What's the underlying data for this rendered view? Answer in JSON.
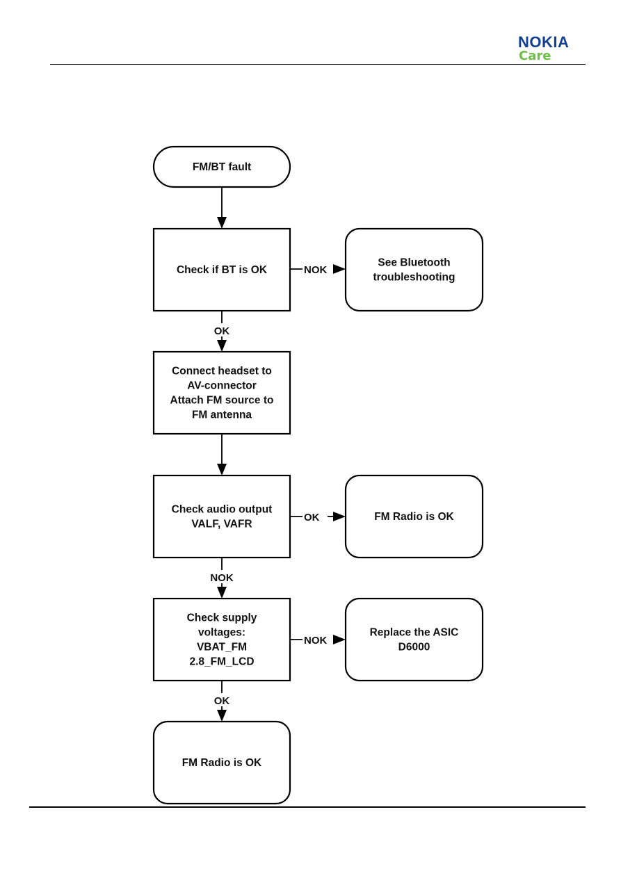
{
  "header": {
    "brand": "NOKIA",
    "subbrand": "Care",
    "brand_color": "#124191",
    "subbrand_color": "#6cbe45"
  },
  "flowchart": {
    "nodes": [
      {
        "id": "start",
        "shape": "terminator",
        "lines": [
          "FM/BT fault"
        ]
      },
      {
        "id": "check_bt",
        "shape": "process",
        "lines": [
          "Check if BT is OK"
        ]
      },
      {
        "id": "bt_trouble",
        "shape": "rounded",
        "lines": [
          "See Bluetooth",
          "troubleshooting"
        ]
      },
      {
        "id": "connect",
        "shape": "process",
        "lines": [
          "Connect headset to",
          "AV-connector",
          "Attach FM source to",
          "FM antenna"
        ]
      },
      {
        "id": "check_audio",
        "shape": "process",
        "lines": [
          "Check audio output",
          "VALF, VAFR"
        ]
      },
      {
        "id": "fm_ok_1",
        "shape": "rounded",
        "lines": [
          "FM Radio is OK"
        ]
      },
      {
        "id": "check_supply",
        "shape": "process",
        "lines": [
          "Check supply",
          "voltages:",
          "VBAT_FM",
          "2.8_FM_LCD"
        ]
      },
      {
        "id": "replace_asic",
        "shape": "rounded",
        "lines": [
          "Replace the ASIC",
          "D6000"
        ]
      },
      {
        "id": "fm_ok_2",
        "shape": "rounded",
        "lines": [
          "FM Radio is OK"
        ]
      }
    ],
    "edges": [
      {
        "from": "start",
        "to": "check_bt",
        "label": ""
      },
      {
        "from": "check_bt",
        "to": "bt_trouble",
        "label": "NOK"
      },
      {
        "from": "check_bt",
        "to": "connect",
        "label": "OK"
      },
      {
        "from": "connect",
        "to": "check_audio",
        "label": ""
      },
      {
        "from": "check_audio",
        "to": "fm_ok_1",
        "label": "OK"
      },
      {
        "from": "check_audio",
        "to": "check_supply",
        "label": "NOK"
      },
      {
        "from": "check_supply",
        "to": "replace_asic",
        "label": "NOK"
      },
      {
        "from": "check_supply",
        "to": "fm_ok_2",
        "label": "OK"
      }
    ]
  }
}
